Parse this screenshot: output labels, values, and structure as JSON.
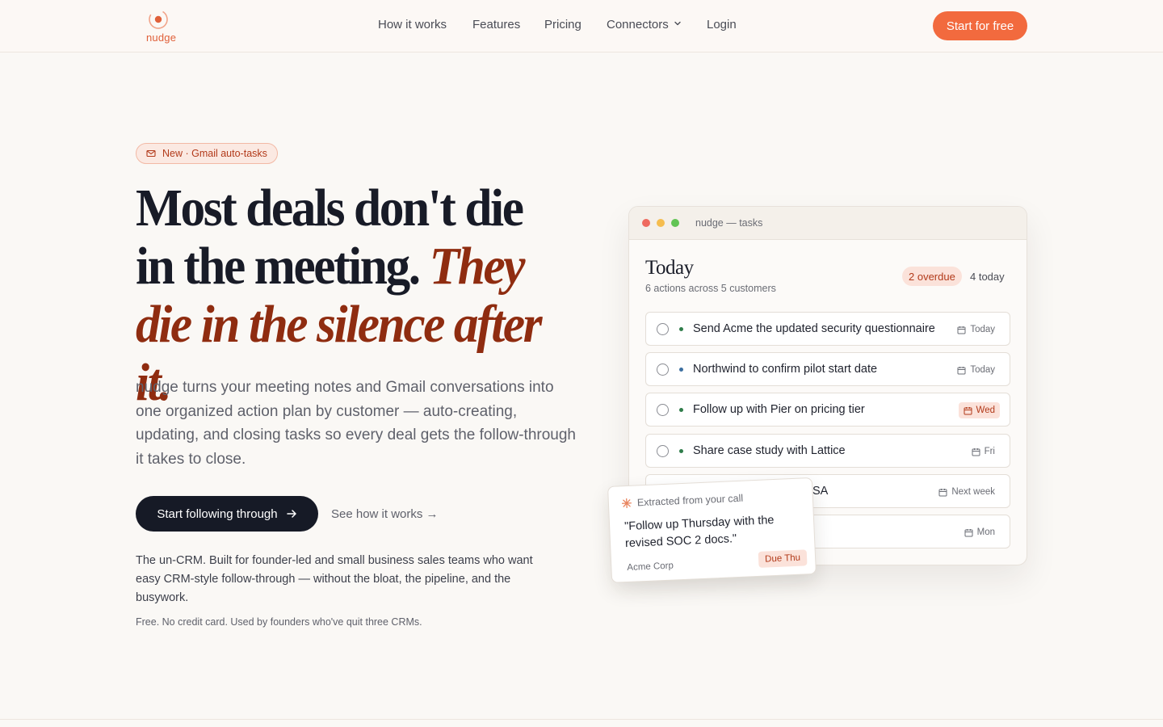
{
  "brand": {
    "name": "nudge",
    "accent": "#f26a3e",
    "deep": "#8f2c10"
  },
  "nav": {
    "links": [
      "How it works",
      "Features",
      "Pricing",
      "Connectors",
      "Login"
    ],
    "cta": "Start for free"
  },
  "hero": {
    "badge": "New · Gmail auto-tasks",
    "headline_plain": "Most deals don't die in the meeting.",
    "headline_em": "They die in the silence after it.",
    "lede": "nudge turns your meeting notes and Gmail conversations into one organized action plan by customer — auto-creating, updating, and closing tasks so every deal gets the follow-through it takes to close.",
    "primary_button": "Start following through",
    "secondary_link": "See how it works →",
    "sub": "The un-CRM. Built for founder-led and small business sales teams who want easy CRM-style follow-through — without the bloat, the pipeline, and the busywork.",
    "fine": "Free. No credit card. Used by founders who've quit three CRMs."
  },
  "app": {
    "window_title": "nudge — tasks",
    "heading": "Today",
    "subheading": "6 actions across 5 customers",
    "overdue": "2 overdue",
    "today_count": "4 today",
    "tasks": [
      {
        "label": "Send Acme the updated security questionnaire",
        "due": "Today",
        "dot": "#2f7d4a",
        "warn": false
      },
      {
        "label": "Northwind to confirm pilot start date",
        "due": "Today",
        "dot": "#3c6fa0",
        "warn": false
      },
      {
        "label": "Follow up with Pier on pricing tier",
        "due": "Wed",
        "dot": "#2f7d4a",
        "warn": true
      },
      {
        "label": "Share case study with Lattice",
        "due": "Fri",
        "dot": "#2f7d4a",
        "warn": false
      },
      {
        "label": "SA",
        "due": "Next week",
        "dot": "#2f7d4a",
        "warn": false
      },
      {
        "label": "",
        "due": "Mon",
        "dot": "#2f7d4a",
        "warn": false
      }
    ]
  },
  "float_card": {
    "header": "Extracted from your call",
    "quote": "\"Follow up Thursday with the revised SOC 2 docs.\"",
    "client": "Acme Corp",
    "due": "Due Thu"
  }
}
